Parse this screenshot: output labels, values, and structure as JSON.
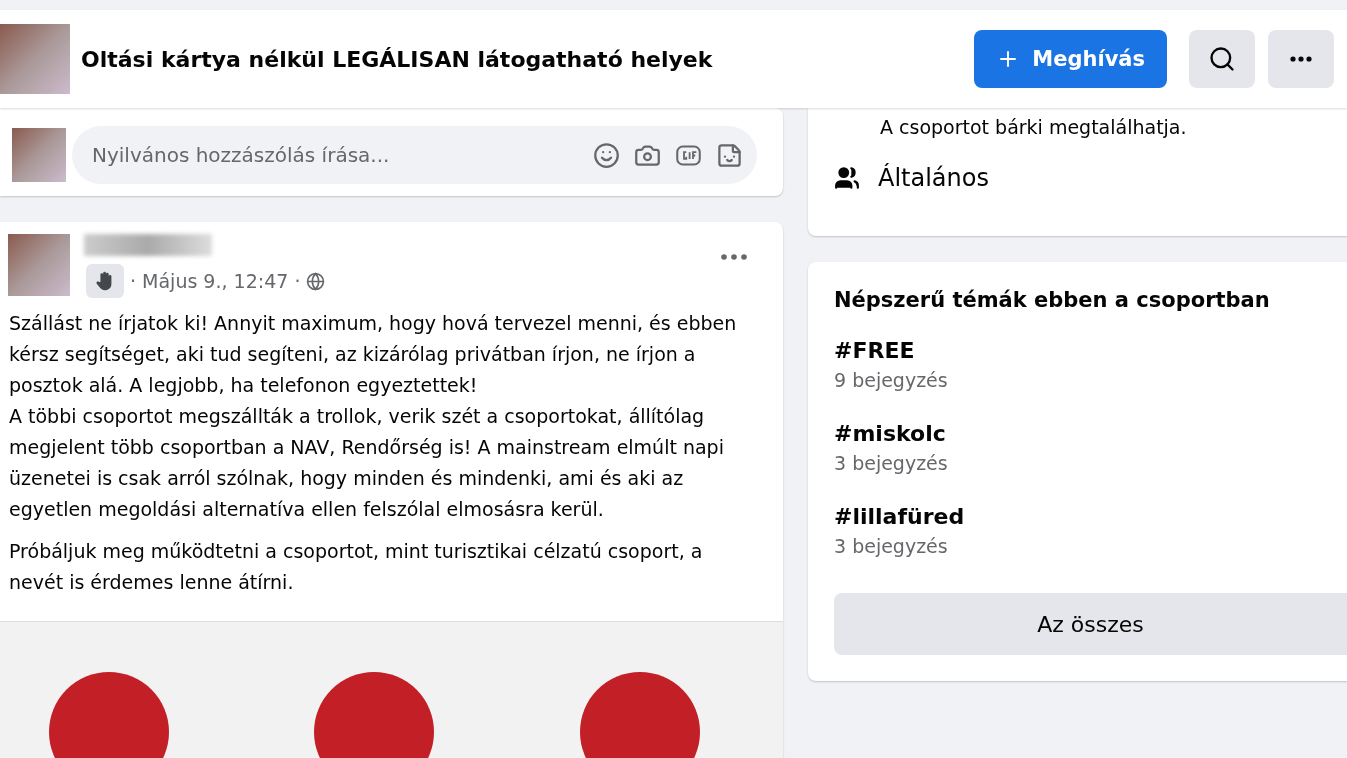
{
  "header": {
    "title": "Oltási kártya nélkül LEGÁLISAN látogatható helyek",
    "invite_button": "Meghívás"
  },
  "comment_box": {
    "placeholder": "Nyilvános hozzászólás írása..."
  },
  "post": {
    "timestamp": "· Május 9., 12:47 ·",
    "paragraphs": [
      "Szállást ne írjatok ki! Annyit maximum, hogy hová tervezel menni, és ebben kérsz segítséget, aki tud segíteni, az kizárólag privátban írjon, ne írjon a posztok alá. A legjobb, ha telefonon egyeztettek!\nA többi csoportot megszállták a trollok, verik szét a csoportokat, állítólag megjelent több csoportban a NAV, Rendőrség is! A mainstream elmúlt napi üzenetei is csak arról szólnak, hogy minden és mindenki, ami és aki az egyetlen megoldási alternatíva ellen felszólal elmosásra kerül.",
      "Próbáljuk meg működtetni a csoportot, mint turisztikai célzatú csoport, a nevét is érdemes lenne átírni."
    ]
  },
  "about": {
    "visibility_text": "A csoportot bárki megtalálhatja.",
    "category": "Általános"
  },
  "topics": {
    "title": "Népszerű témák ebben a csoportban",
    "items": [
      {
        "tag": "#FREE",
        "count": "9 bejegyzés"
      },
      {
        "tag": "#miskolc",
        "count": "3 bejegyzés"
      },
      {
        "tag": "#lillafüred",
        "count": "3 bejegyzés"
      }
    ],
    "button": "Az összes"
  }
}
